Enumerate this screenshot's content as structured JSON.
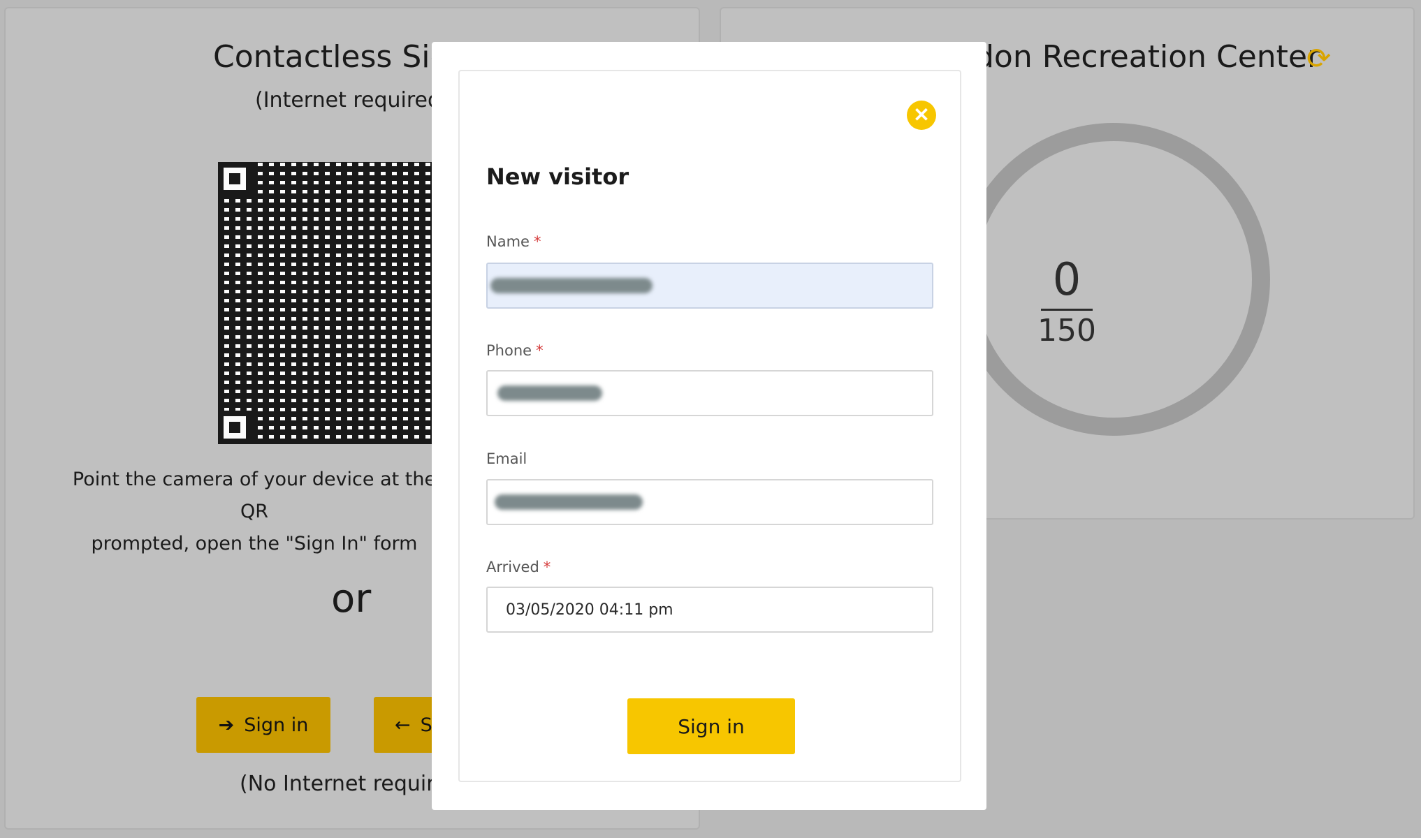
{
  "left_panel": {
    "title": "Contactless Sig",
    "subtitle": "(Internet required",
    "instructions_line1": "Point the camera of your device at the QR",
    "instructions_line2": "prompted, open the \"Sign In\" form",
    "or": "or",
    "sign_in_label": "Sign in",
    "sign_out_label": "Si",
    "no_internet": "(No Internet requir"
  },
  "right_panel": {
    "title": "don Recreation Center",
    "refresh_icon": "refresh-icon",
    "current_count": "0",
    "capacity": "150",
    "gauge_color": "#9c9c9c"
  },
  "modal": {
    "title": "New visitor",
    "close_icon": "close-icon",
    "fields": {
      "name": {
        "label": "Name",
        "required": "*",
        "value": "",
        "redacted": true
      },
      "phone": {
        "label": "Phone",
        "required": "*",
        "value": "",
        "redacted": true
      },
      "email": {
        "label": "Email",
        "value": "",
        "redacted": true
      },
      "arrived": {
        "label": "Arrived",
        "required": "*",
        "value": "03/05/2020 04:11 pm"
      }
    },
    "submit_label": "Sign in",
    "accent_color": "#f7c600"
  }
}
